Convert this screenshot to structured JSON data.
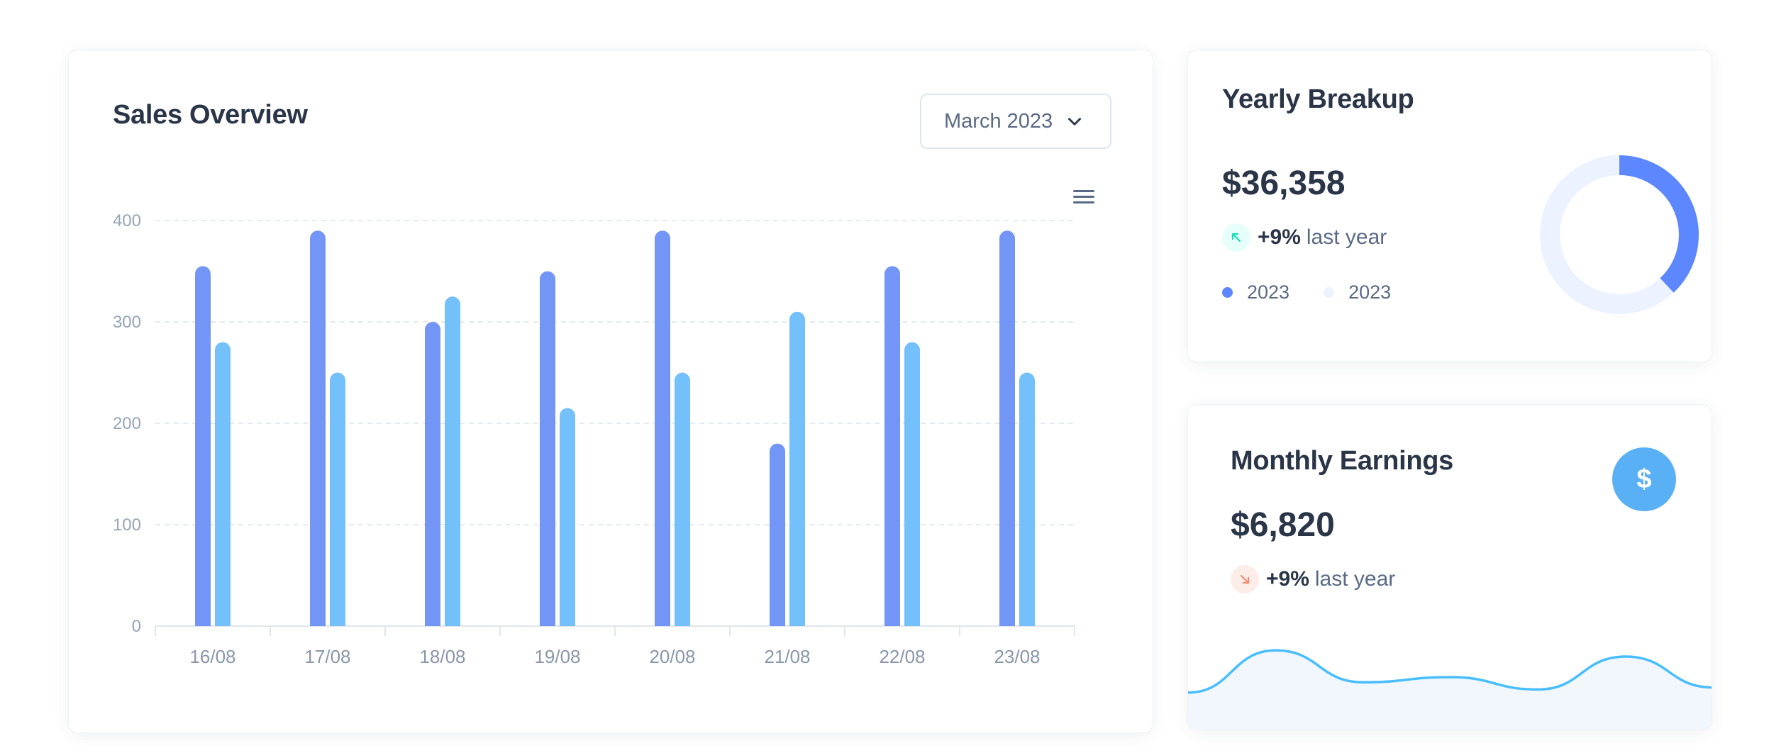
{
  "sales_overview": {
    "title": "Sales Overview",
    "month_select": "March 2023",
    "menu_icon": "hamburger-menu-icon"
  },
  "chart_data": {
    "type": "bar",
    "categories": [
      "16/08",
      "17/08",
      "18/08",
      "19/08",
      "20/08",
      "21/08",
      "22/08",
      "23/08"
    ],
    "series": [
      {
        "values": [
          355,
          390,
          300,
          350,
          390,
          180,
          355,
          390
        ],
        "color": "#7395f5"
      },
      {
        "values": [
          280,
          250,
          325,
          215,
          250,
          310,
          280,
          250
        ],
        "color": "#74c0fa"
      }
    ],
    "yticks": [
      0,
      100,
      200,
      300,
      400
    ],
    "ylim": [
      0,
      400
    ],
    "grid": true,
    "legend": false
  },
  "yearly_breakup": {
    "title": "Yearly Breakup",
    "amount": "$36,358",
    "trend_pct": "+9%",
    "trend_label": "last year",
    "trend_icon": "arrow-up-left-icon",
    "legend": [
      {
        "label": "2023",
        "color": "#5d87ff"
      },
      {
        "label": "2023",
        "color": "#ecf2ff"
      }
    ],
    "donut": {
      "primary_fraction": 0.38,
      "primary_color": "#5d87ff",
      "secondary_color": "#ecf2ff"
    }
  },
  "monthly_earnings": {
    "title": "Monthly Earnings",
    "amount": "$6,820",
    "trend_pct": "+9%",
    "trend_label": "last year",
    "trend_icon": "arrow-down-right-icon",
    "dollar_icon": "$",
    "sparkline": {
      "values": [
        25,
        66,
        35,
        40,
        28,
        60,
        30
      ],
      "color": "#49beff"
    }
  }
}
